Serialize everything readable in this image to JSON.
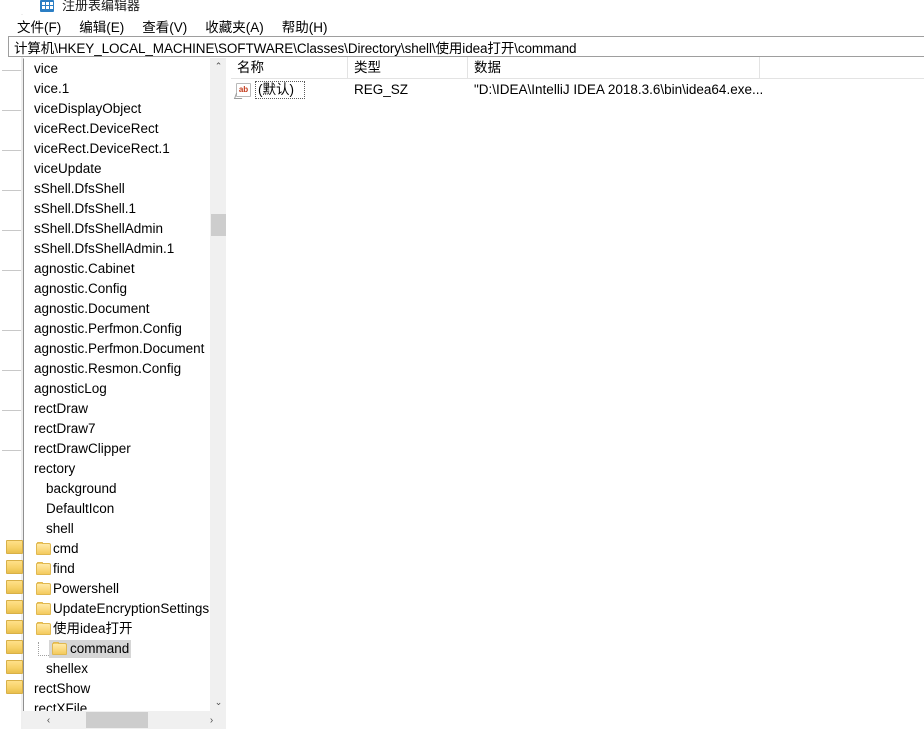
{
  "window": {
    "title": "注册表编辑器",
    "icon": "registry-icon"
  },
  "menu": {
    "items": [
      {
        "label": "文件(F)",
        "name": "menu-file"
      },
      {
        "label": "编辑(E)",
        "name": "menu-edit"
      },
      {
        "label": "查看(V)",
        "name": "menu-view"
      },
      {
        "label": "收藏夹(A)",
        "name": "menu-favorites"
      },
      {
        "label": "帮助(H)",
        "name": "menu-help"
      }
    ]
  },
  "address": {
    "path": "计算机\\HKEY_LOCAL_MACHINE\\SOFTWARE\\Classes\\Directory\\shell\\使用idea打开\\command"
  },
  "tree": {
    "scrolled_horizontally": true,
    "items": [
      {
        "label": "vice",
        "indent": 0,
        "folder": false,
        "selected": false
      },
      {
        "label": "vice.1",
        "indent": 0,
        "folder": false,
        "selected": false
      },
      {
        "label": "viceDisplayObject",
        "indent": 0,
        "folder": false,
        "selected": false
      },
      {
        "label": "viceRect.DeviceRect",
        "indent": 0,
        "folder": false,
        "selected": false
      },
      {
        "label": "viceRect.DeviceRect.1",
        "indent": 0,
        "folder": false,
        "selected": false
      },
      {
        "label": "viceUpdate",
        "indent": 0,
        "folder": false,
        "selected": false
      },
      {
        "label": "sShell.DfsShell",
        "indent": 0,
        "folder": false,
        "selected": false
      },
      {
        "label": "sShell.DfsShell.1",
        "indent": 0,
        "folder": false,
        "selected": false
      },
      {
        "label": "sShell.DfsShellAdmin",
        "indent": 0,
        "folder": false,
        "selected": false
      },
      {
        "label": "sShell.DfsShellAdmin.1",
        "indent": 0,
        "folder": false,
        "selected": false
      },
      {
        "label": "agnostic.Cabinet",
        "indent": 0,
        "folder": false,
        "selected": false
      },
      {
        "label": "agnostic.Config",
        "indent": 0,
        "folder": false,
        "selected": false
      },
      {
        "label": "agnostic.Document",
        "indent": 0,
        "folder": false,
        "selected": false
      },
      {
        "label": "agnostic.Perfmon.Config",
        "indent": 0,
        "folder": false,
        "selected": false
      },
      {
        "label": "agnostic.Perfmon.Document",
        "indent": 0,
        "folder": false,
        "selected": false
      },
      {
        "label": "agnostic.Resmon.Config",
        "indent": 0,
        "folder": false,
        "selected": false
      },
      {
        "label": "agnosticLog",
        "indent": 0,
        "folder": false,
        "selected": false
      },
      {
        "label": "rectDraw",
        "indent": 0,
        "folder": false,
        "selected": false
      },
      {
        "label": "rectDraw7",
        "indent": 0,
        "folder": false,
        "selected": false
      },
      {
        "label": "rectDrawClipper",
        "indent": 0,
        "folder": false,
        "selected": false
      },
      {
        "label": "rectory",
        "indent": 0,
        "folder": false,
        "selected": false
      },
      {
        "label": "background",
        "indent": 1,
        "folder": false,
        "selected": false
      },
      {
        "label": "DefaultIcon",
        "indent": 1,
        "folder": false,
        "selected": false
      },
      {
        "label": "shell",
        "indent": 1,
        "folder": false,
        "selected": false
      },
      {
        "label": "cmd",
        "indent": 2,
        "folder": true,
        "selected": false
      },
      {
        "label": "find",
        "indent": 2,
        "folder": true,
        "selected": false
      },
      {
        "label": "Powershell",
        "indent": 2,
        "folder": true,
        "selected": false
      },
      {
        "label": "UpdateEncryptionSettings",
        "indent": 2,
        "folder": true,
        "selected": false
      },
      {
        "label": "使用idea打开",
        "indent": 2,
        "folder": true,
        "selected": false
      },
      {
        "label": "command",
        "indent": 3,
        "folder": true,
        "selected": true
      },
      {
        "label": "shellex",
        "indent": 1,
        "folder": false,
        "selected": false
      },
      {
        "label": "rectShow",
        "indent": 0,
        "folder": false,
        "selected": false
      },
      {
        "label": "rectXFile",
        "indent": 0,
        "folder": false,
        "selected": false
      }
    ]
  },
  "list": {
    "columns": [
      {
        "label": "名称",
        "name": "column-name"
      },
      {
        "label": "类型",
        "name": "column-type"
      },
      {
        "label": "数据",
        "name": "column-data"
      }
    ],
    "rows": [
      {
        "icon": "string-value-icon",
        "icon_glyph": "ab",
        "name": "(默认)",
        "type": "REG_SZ",
        "data": "\"D:\\IDEA\\IntelliJ IDEA 2018.3.6\\bin\\idea64.exe..."
      }
    ]
  },
  "scrollbars": {
    "tree_vertical": {
      "up_arrow": "⌃",
      "down_arrow": "⌄"
    },
    "tree_horizontal": {
      "left_arrow": "‹",
      "right_arrow": "›"
    }
  },
  "colors": {
    "selection": "#d6d6d6",
    "folder": "#f3ca5d",
    "scrollbar_thumb": "#cdcdcd",
    "icon_text": "#c33a1a",
    "border": "#9e9e9e"
  }
}
